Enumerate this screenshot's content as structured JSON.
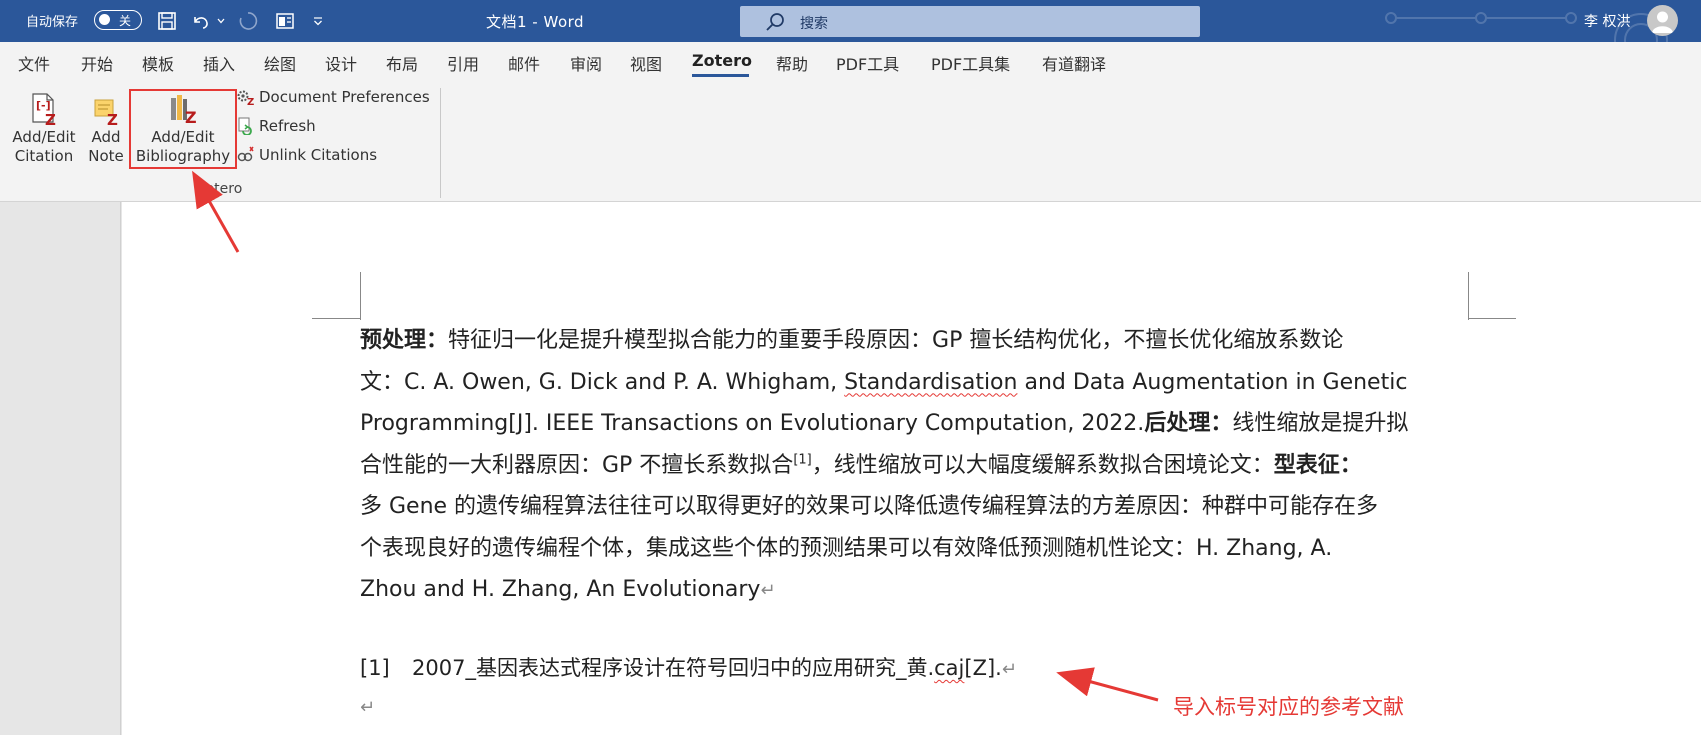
{
  "titlebar": {
    "autosave_label": "自动保存",
    "autosave_state": "关",
    "doc_title": "文档1  -  Word",
    "search_placeholder": "搜索",
    "username": "李 权洪",
    "icons": [
      "save-icon",
      "undo-icon",
      "redo-icon",
      "layout-icon",
      "customize-qat-icon",
      "search-icon",
      "avatar-icon"
    ]
  },
  "tabs": [
    {
      "label": "文件"
    },
    {
      "label": "开始"
    },
    {
      "label": "模板"
    },
    {
      "label": "插入"
    },
    {
      "label": "绘图"
    },
    {
      "label": "设计"
    },
    {
      "label": "布局"
    },
    {
      "label": "引用"
    },
    {
      "label": "邮件"
    },
    {
      "label": "审阅"
    },
    {
      "label": "视图"
    },
    {
      "label": "Zotero"
    },
    {
      "label": "帮助"
    },
    {
      "label": "PDF工具"
    },
    {
      "label": "PDF工具集"
    },
    {
      "label": "有道翻译"
    }
  ],
  "active_tab": "Zotero",
  "ribbon": {
    "add_edit_citation": [
      "Add/Edit",
      "Citation"
    ],
    "add_note": [
      "Add",
      "Note"
    ],
    "add_edit_bibliography": [
      "Add/Edit",
      "Bibliography"
    ],
    "document_preferences": "Document Preferences",
    "refresh": "Refresh",
    "unlink_citations": "Unlink Citations",
    "group_label": "Zotero"
  },
  "document": {
    "lines": [
      {
        "segments": [
          {
            "b": true,
            "t": "预处理："
          },
          {
            "t": "特征归一化是提升模型拟合能力的重要手段原因：GP 擅长结构优化，不擅长优化缩放系数论"
          }
        ]
      },
      {
        "segments": [
          {
            "t": "文：C. A. Owen, G. Dick and P. A. Whigham, "
          },
          {
            "wavy": true,
            "t": "Standardisation"
          },
          {
            "t": " and Data Augmentation in Genetic"
          }
        ]
      },
      {
        "segments": [
          {
            "t": "Programming[J]. IEEE Transactions on Evolutionary Computation, 2022."
          },
          {
            "b": true,
            "t": "后处理："
          },
          {
            "t": "线性缩放是提升拟"
          }
        ]
      },
      {
        "segments": [
          {
            "t": "合性能的一大利器原因：GP 不擅长系数拟合"
          },
          {
            "sup": true,
            "t": "[1]"
          },
          {
            "t": "，线性缩放可以大幅度缓解系数拟合困境论文："
          },
          {
            "b": true,
            "t": "型表征："
          }
        ]
      },
      {
        "segments": [
          {
            "t": "多 Gene 的遗传编程算法往往可以取得更好的效果可以降低遗传编程算法的方差原因：种群中可能存在多"
          }
        ]
      },
      {
        "segments": [
          {
            "t": "个表现良好的遗传编程个体，集成这些个体的预测结果可以有效降低预测随机性论文：H. Zhang, A."
          }
        ]
      },
      {
        "segments": [
          {
            "t": "Zhou and H. Zhang, An Evolutionary"
          },
          {
            "pm": true,
            "t": "↵"
          }
        ]
      }
    ],
    "reference": {
      "number": "[1]",
      "text_before": "2007_基因表达式程序设计在符号回归中的应用研究_黄.",
      "text_wavy": "caj",
      "text_after": "[Z].",
      "para_mark": "↵"
    },
    "empty_para_mark": "↵"
  },
  "annotation": {
    "text": "导入标号对应的参考文献",
    "color": "#e53935"
  },
  "colors": {
    "title_bar": "#2b579a",
    "ribbon_bg": "#f3f3f3",
    "highlight": "#e53935"
  }
}
